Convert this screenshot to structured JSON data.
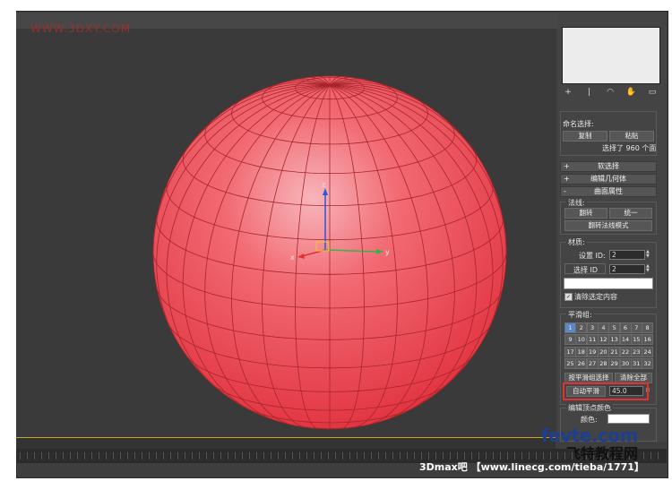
{
  "watermark_top": "WWW.3DXY.COM",
  "viewport": {
    "axis_labels": {
      "x": "x",
      "y": "y",
      "z": "z"
    },
    "colors": {
      "sphere": "#f04a55",
      "wire": "#a8252c",
      "x_axis": "#e33030",
      "y_axis": "#34b44a",
      "z_axis": "#2a55e0"
    }
  },
  "command_panel": {
    "tabs": [
      "+",
      "|",
      "◠",
      "✋",
      "▭"
    ],
    "named_selection_label": "命名选择:",
    "copy_button": "复制",
    "paste_button": "粘贴",
    "selection_status": "选择了 960 个面",
    "rollouts": [
      {
        "sign": "+",
        "label": "软选择"
      },
      {
        "sign": "+",
        "label": "编辑几何体"
      },
      {
        "sign": "-",
        "label": "曲面属性"
      }
    ],
    "normals": {
      "label": "法线:",
      "flip_button": "翻转",
      "unify_button": "统一",
      "flip_mode_button": "翻转法线模式"
    },
    "material": {
      "label": "材质:",
      "set_id_label": "设置 ID:",
      "set_id_value": "2",
      "select_id_label": "选择 ID",
      "select_id_value": "2",
      "clear_selection_label": "清除选定内容"
    },
    "smoothing": {
      "label": "平滑组:",
      "groups": [
        "1",
        "2",
        "3",
        "4",
        "5",
        "6",
        "7",
        "8",
        "9",
        "10",
        "11",
        "12",
        "13",
        "14",
        "15",
        "16",
        "17",
        "18",
        "19",
        "20",
        "21",
        "22",
        "23",
        "24",
        "25",
        "26",
        "27",
        "28",
        "29",
        "30",
        "31",
        "32"
      ],
      "active_group": "1",
      "select_by_smooth_button": "按平滑组选择",
      "clear_all_button": "清除全部",
      "auto_smooth_button": "自动平滑",
      "auto_smooth_value": "45.0"
    },
    "vertex_colors": {
      "label": "编辑顶点颜色",
      "color_label": "颜色:",
      "color_value": "#ffffff"
    }
  },
  "bottom_watermark": "3Dmax吧 【www.linecg.com/tieba/1771】",
  "logo": {
    "en": "fevte.com",
    "cn": "飞特教程网"
  }
}
